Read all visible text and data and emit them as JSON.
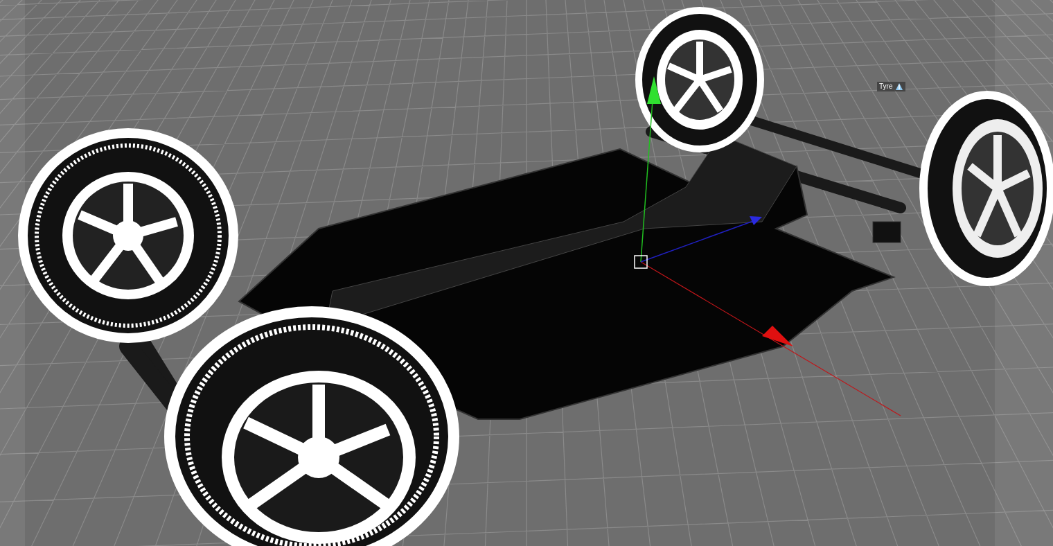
{
  "viewport": {
    "object_label": "Tyre"
  }
}
